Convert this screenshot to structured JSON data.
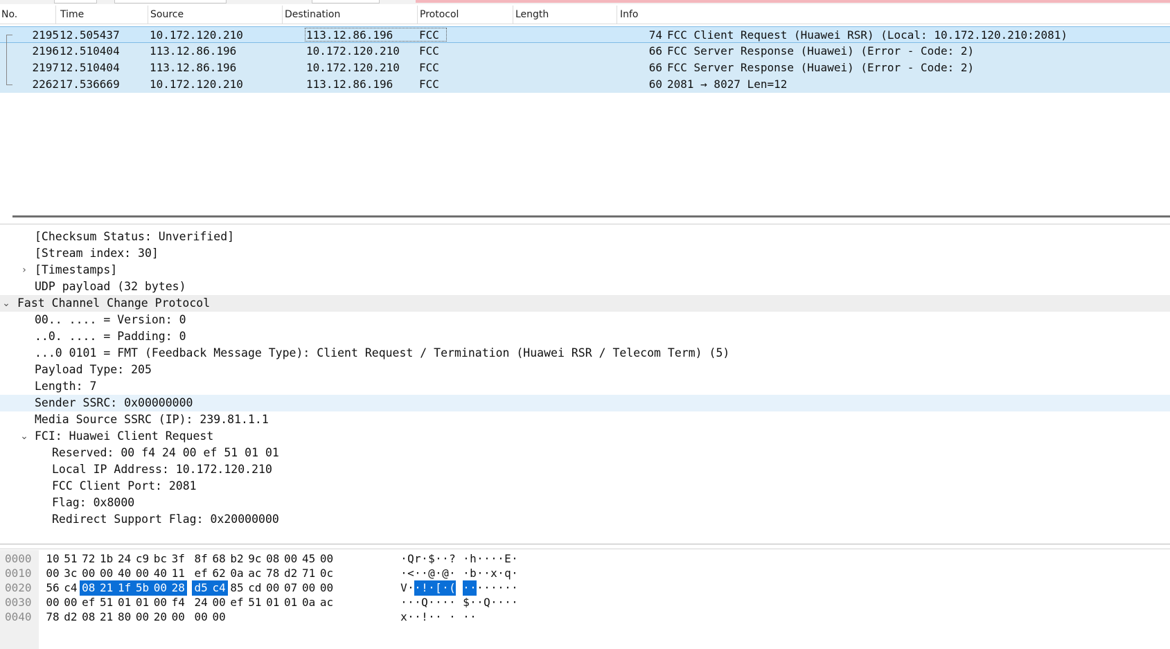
{
  "colors": {
    "row_bg": "#d5eaf7",
    "selected_row_bg": "#cde8fa",
    "hex_selection": "#0a6fd8",
    "section_highlight": "#eeeeee",
    "field_highlight": "#e6f2fb"
  },
  "packet_list": {
    "columns": [
      "No.",
      "Time",
      "Source",
      "Destination",
      "Protocol",
      "Length",
      "Info"
    ],
    "rows": [
      {
        "no": "2195",
        "time": "12.505437",
        "src": "10.172.120.210",
        "dst": "113.12.86.196",
        "proto": "FCC",
        "len": "74",
        "info": "FCC Client Request (Huawei RSR) (Local: 10.172.120.210:2081)"
      },
      {
        "no": "2196",
        "time": "12.510404",
        "src": "113.12.86.196",
        "dst": "10.172.120.210",
        "proto": "FCC",
        "len": "66",
        "info": "FCC Server Response (Huawei) (Error - Code: 2)"
      },
      {
        "no": "2197",
        "time": "12.510404",
        "src": "113.12.86.196",
        "dst": "10.172.120.210",
        "proto": "FCC",
        "len": "66",
        "info": "FCC Server Response (Huawei) (Error - Code: 2)"
      },
      {
        "no": "2262",
        "time": "17.536669",
        "src": "10.172.120.210",
        "dst": "113.12.86.196",
        "proto": "FCC",
        "len": "60",
        "info": "2081 → 8027 Len=12"
      }
    ]
  },
  "detail": [
    {
      "indent": 2,
      "arrow": "",
      "text": "[Checksum Status: Unverified]",
      "hl": ""
    },
    {
      "indent": 2,
      "arrow": "",
      "text": "[Stream index: 30]",
      "hl": ""
    },
    {
      "indent": 2,
      "arrow": "›",
      "text": "[Timestamps]",
      "hl": ""
    },
    {
      "indent": 2,
      "arrow": "",
      "text": "UDP payload (32 bytes)",
      "hl": ""
    },
    {
      "indent": 1,
      "arrow": "⌄",
      "text": "Fast Channel Change Protocol",
      "hl": "gray"
    },
    {
      "indent": 2,
      "arrow": "",
      "text": "00.. .... = Version: 0",
      "hl": ""
    },
    {
      "indent": 2,
      "arrow": "",
      "text": "..0. .... = Padding: 0",
      "hl": ""
    },
    {
      "indent": 2,
      "arrow": "",
      "text": "...0 0101 = FMT (Feedback Message Type): Client Request / Termination (Huawei RSR / Telecom Term) (5)",
      "hl": ""
    },
    {
      "indent": 2,
      "arrow": "",
      "text": "Payload Type: 205",
      "hl": ""
    },
    {
      "indent": 2,
      "arrow": "",
      "text": "Length: 7",
      "hl": ""
    },
    {
      "indent": 2,
      "arrow": "",
      "text": "Sender SSRC: 0x00000000",
      "hl": "blue"
    },
    {
      "indent": 2,
      "arrow": "",
      "text": "Media Source SSRC (IP): 239.81.1.1",
      "hl": ""
    },
    {
      "indent": 2,
      "arrow": "⌄",
      "text": "FCI: Huawei Client Request",
      "hl": ""
    },
    {
      "indent": 3,
      "arrow": "",
      "text": "Reserved: 00 f4 24 00 ef 51 01 01",
      "hl": ""
    },
    {
      "indent": 3,
      "arrow": "",
      "text": "Local IP Address: 10.172.120.210",
      "hl": ""
    },
    {
      "indent": 3,
      "arrow": "",
      "text": "FCC Client Port: 2081",
      "hl": ""
    },
    {
      "indent": 3,
      "arrow": "",
      "text": "Flag: 0x8000",
      "hl": ""
    },
    {
      "indent": 3,
      "arrow": "",
      "text": "Redirect Support Flag: 0x20000000",
      "hl": ""
    }
  ],
  "hex": [
    {
      "offset": "0000",
      "bytes": [
        "10",
        "51",
        "72",
        "1b",
        "24",
        "c9",
        "bc",
        "3f",
        "8f",
        "68",
        "b2",
        "9c",
        "08",
        "00",
        "45",
        "00"
      ],
      "ascii": [
        "·",
        "Q",
        "r",
        "·",
        "$",
        "·",
        "·",
        "?",
        "·",
        "h",
        "·",
        "·",
        "·",
        "·",
        "E",
        "·"
      ]
    },
    {
      "offset": "0010",
      "bytes": [
        "00",
        "3c",
        "00",
        "00",
        "40",
        "00",
        "40",
        "11",
        "ef",
        "62",
        "0a",
        "ac",
        "78",
        "d2",
        "71",
        "0c"
      ],
      "ascii": [
        "·",
        "<",
        "·",
        "·",
        "@",
        "·",
        "@",
        "·",
        "·",
        "b",
        "·",
        "·",
        "x",
        "·",
        "q",
        "·"
      ]
    },
    {
      "offset": "0020",
      "bytes": [
        "56",
        "c4",
        "08",
        "21",
        "1f",
        "5b",
        "00",
        "28",
        "d5",
        "c4",
        "85",
        "cd",
        "00",
        "07",
        "00",
        "00"
      ],
      "ascii": [
        "V",
        "·",
        "·",
        "!",
        "·",
        "[",
        "·",
        "(",
        "·",
        "·",
        "·",
        "·",
        "·",
        "·",
        "·",
        "·"
      ]
    },
    {
      "offset": "0030",
      "bytes": [
        "00",
        "00",
        "ef",
        "51",
        "01",
        "01",
        "00",
        "f4",
        "24",
        "00",
        "ef",
        "51",
        "01",
        "01",
        "0a",
        "ac"
      ],
      "ascii": [
        "·",
        "·",
        "·",
        "Q",
        "·",
        "·",
        "·",
        "·",
        "$",
        "·",
        "·",
        "Q",
        "·",
        "·",
        "·",
        "·"
      ]
    },
    {
      "offset": "0040",
      "bytes": [
        "78",
        "d2",
        "08",
        "21",
        "80",
        "00",
        "20",
        "00",
        "00",
        "00"
      ],
      "ascii": [
        "x",
        "·",
        "·",
        "!",
        "·",
        "·",
        "",
        "·",
        "·",
        "·"
      ]
    }
  ]
}
